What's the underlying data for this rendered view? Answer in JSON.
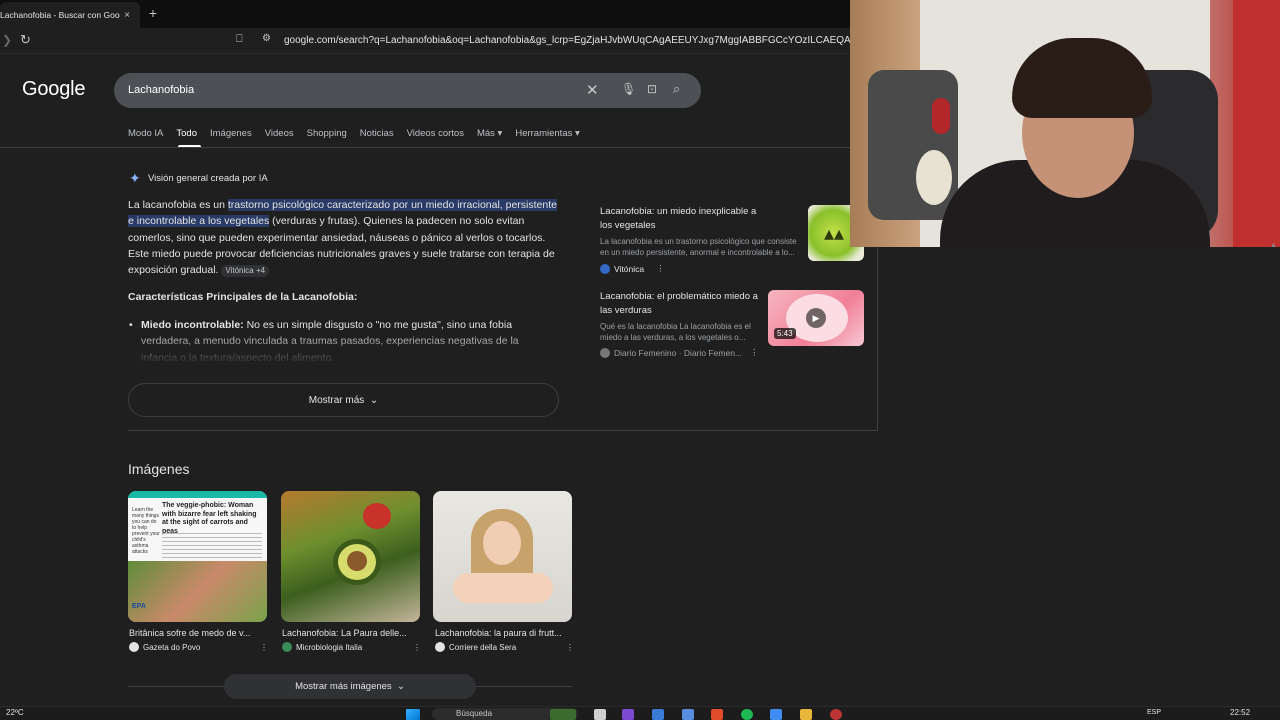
{
  "browser": {
    "tab_title": "Lachanofobia - Buscar con Goog",
    "tab_close": "×",
    "new_tab": "+",
    "url": "google.com/search?q=Lachanofobia&oq=Lachanofobia&gs_lcrp=EgZjaHJvbWUqCAgAEEUYJxg7MggIABBFGCcYOzILCAEQABgKGAsYgAQ"
  },
  "google": {
    "logo": "Google",
    "query": "Lachanofobia",
    "tabs": [
      "Modo IA",
      "Todo",
      "Imágenes",
      "Videos",
      "Shopping",
      "Noticias",
      "Videos cortos",
      "Más ▾",
      "Herramientas ▾"
    ],
    "active_tab": "Todo"
  },
  "ai_overview": {
    "label": "Visión general creada por IA",
    "intro_plain": "La lacanofobia es un ",
    "intro_highlight": "trastorno psicológico caracterizado por un miedo irracional, persistente e incontrolable a los vegetales",
    "intro_rest": " (verduras y frutas). Quienes la padecen no solo evitan comerlos, sino que pueden experimentar ansiedad, náuseas o pánico al verlos o tocarlos. Este miedo puede provocar deficiencias nutricionales graves y suele tratarse con terapia de exposición gradual.",
    "source_chip": "Vitónica +4",
    "heading": "Características Principales de la Lacanofobia:",
    "bullet_title": "Miedo incontrolable:",
    "bullet_text": " No es un simple disgusto o \"no me gusta\", sino una fobia verdadera, a menudo vinculada a traumas pasados, experiencias negativas de la infancia o la textura/aspecto del alimento.",
    "show_more": "Mostrar más"
  },
  "sources": [
    {
      "title": "Lacanofobia: un miedo inexplicable a los vegetales",
      "snippet": "La lacanofobia es un trastorno psicológico que consiste en un miedo persistente, anormal e incontrolable a lo...",
      "source": "Vitónica"
    },
    {
      "title": "Lacanofobia: el problemático miedo a las verduras",
      "snippet": "Qué es la lacanofobia La lacanofobia es el miedo a las verduras, a los vegetales o...",
      "source": "Diario Femenino · Diario Femen...",
      "duration": "5:43"
    }
  ],
  "images": {
    "heading": "Imágenes",
    "items": [
      {
        "caption": "Britânica sofre de medo de v...",
        "source": "Gazeta do Povo",
        "thumb_text": "The veggie-phobic: Woman with bizarre fear left shaking at the sight of carrots and peas",
        "side_text": "Learn the many things you can do to help prevent your child's asthma attacks",
        "badge": "EPA"
      },
      {
        "caption": "Lachanofobia: La Paura delle...",
        "source": "Microbiologia Italia"
      },
      {
        "caption": "Lachanofobia: la paura di frutt...",
        "source": "Corriere della Sera"
      }
    ],
    "show_more": "Mostrar más imágenes"
  },
  "taskbar": {
    "temperature": "22ºC",
    "search_placeholder": "Búsqueda",
    "language": "ESP",
    "time": "22:52"
  }
}
